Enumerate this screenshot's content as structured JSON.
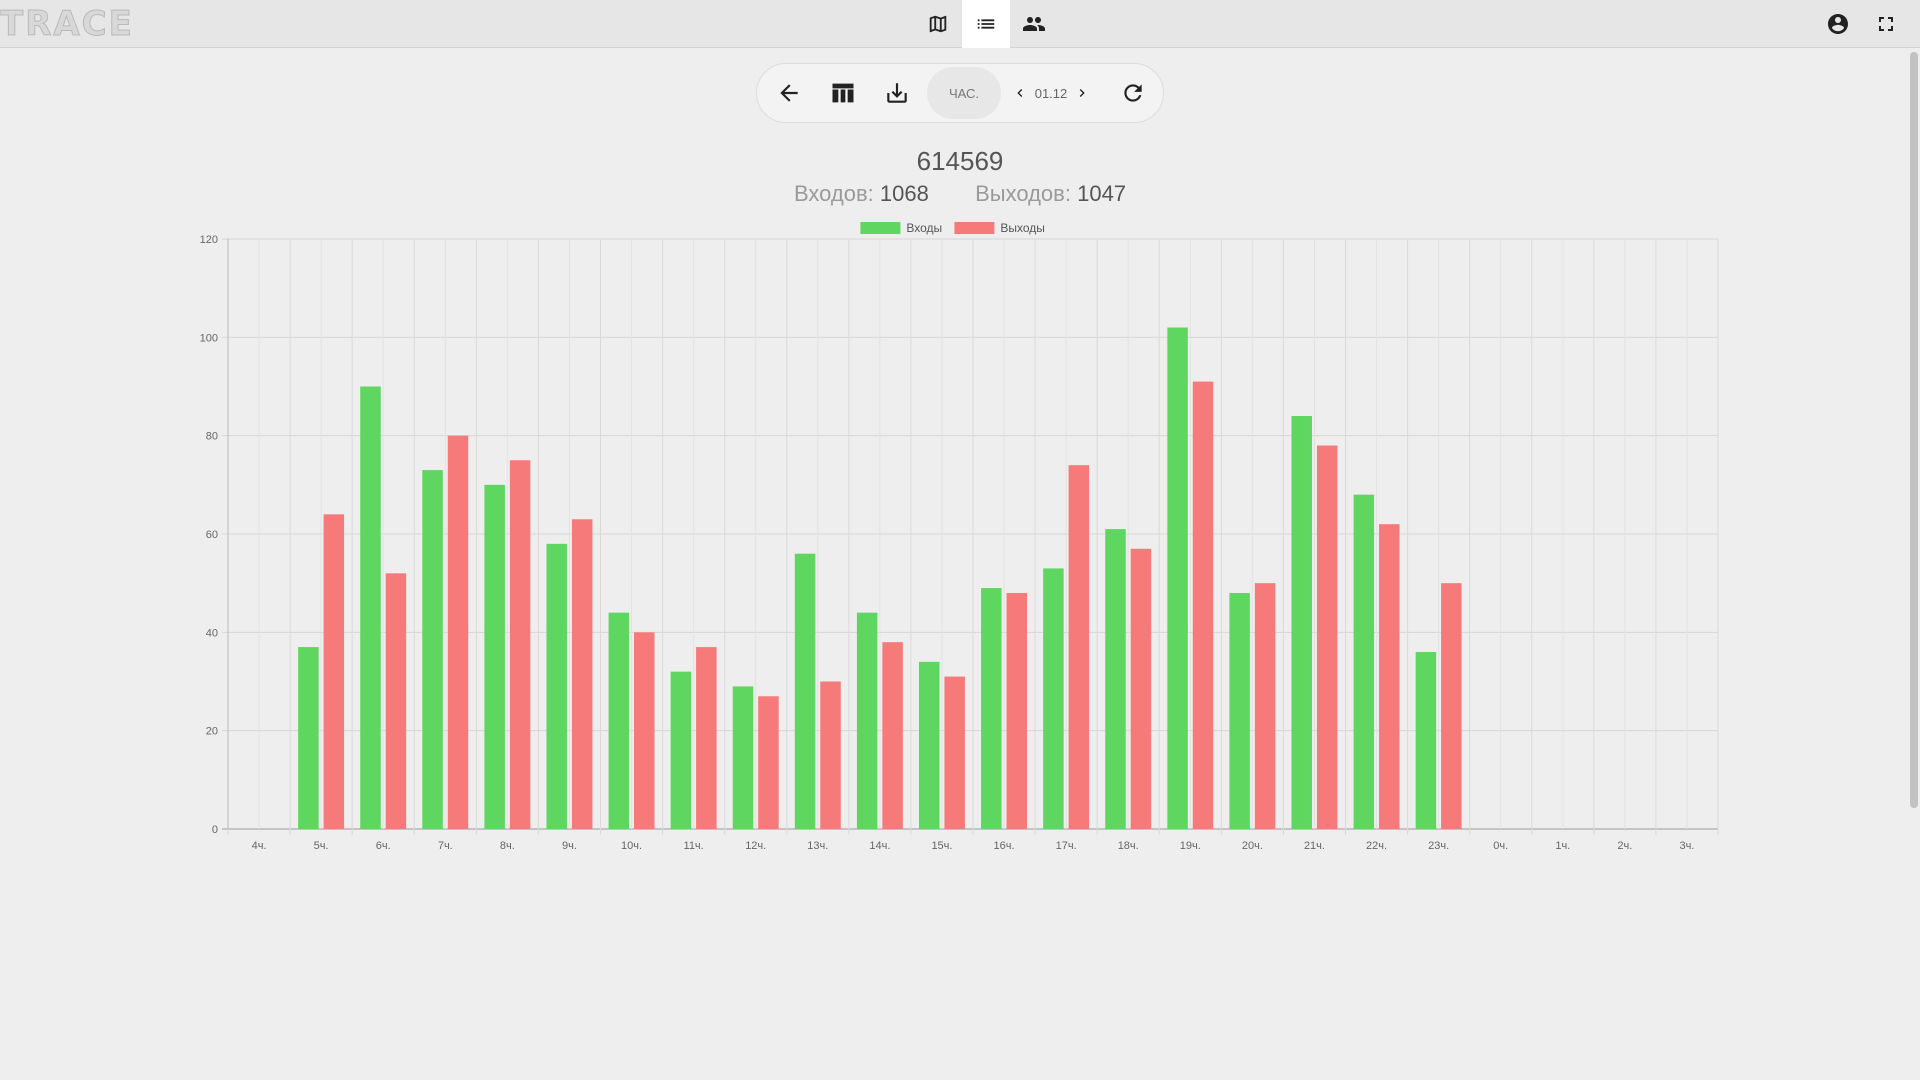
{
  "app": {
    "logo_text": "TRACE"
  },
  "nav": {
    "tabs": [
      {
        "icon": "map-icon"
      },
      {
        "icon": "list-icon",
        "active": true
      },
      {
        "icon": "people-icon"
      }
    ],
    "right": [
      {
        "icon": "account-icon"
      },
      {
        "icon": "fullscreen-icon"
      }
    ]
  },
  "toolbar": {
    "period_label": "ЧАС.",
    "date": "01.12",
    "icons": [
      "back-arrow-icon",
      "columns-icon",
      "download-icon",
      "chevron-left-icon",
      "chevron-right-icon",
      "refresh-icon"
    ]
  },
  "header": {
    "title": "614569",
    "entries_label": "Входов:",
    "entries_value": "1068",
    "exits_label": "Выходов:",
    "exits_value": "1047"
  },
  "chart_data": {
    "type": "bar",
    "title": "",
    "xlabel": "",
    "ylabel": "",
    "ylim": [
      0,
      120
    ],
    "yticks": [
      0,
      20,
      40,
      60,
      80,
      100,
      120
    ],
    "grid": true,
    "legend_position": "top",
    "categories": [
      "4ч.",
      "5ч.",
      "6ч.",
      "7ч.",
      "8ч.",
      "9ч.",
      "10ч.",
      "11ч.",
      "12ч.",
      "13ч.",
      "14ч.",
      "15ч.",
      "16ч.",
      "17ч.",
      "18ч.",
      "19ч.",
      "20ч.",
      "21ч.",
      "22ч.",
      "23ч.",
      "0ч.",
      "1ч.",
      "2ч.",
      "3ч."
    ],
    "series": [
      {
        "name": "Входы",
        "color": "#5fd65f",
        "values": [
          null,
          37,
          90,
          73,
          70,
          58,
          44,
          32,
          29,
          56,
          44,
          34,
          49,
          53,
          61,
          102,
          48,
          84,
          68,
          36,
          null,
          null,
          null,
          null
        ]
      },
      {
        "name": "Выходы",
        "color": "#f77a7a",
        "values": [
          null,
          64,
          52,
          80,
          75,
          63,
          40,
          37,
          27,
          30,
          38,
          31,
          48,
          74,
          57,
          91,
          50,
          78,
          62,
          50,
          null,
          null,
          null,
          null
        ]
      }
    ]
  }
}
